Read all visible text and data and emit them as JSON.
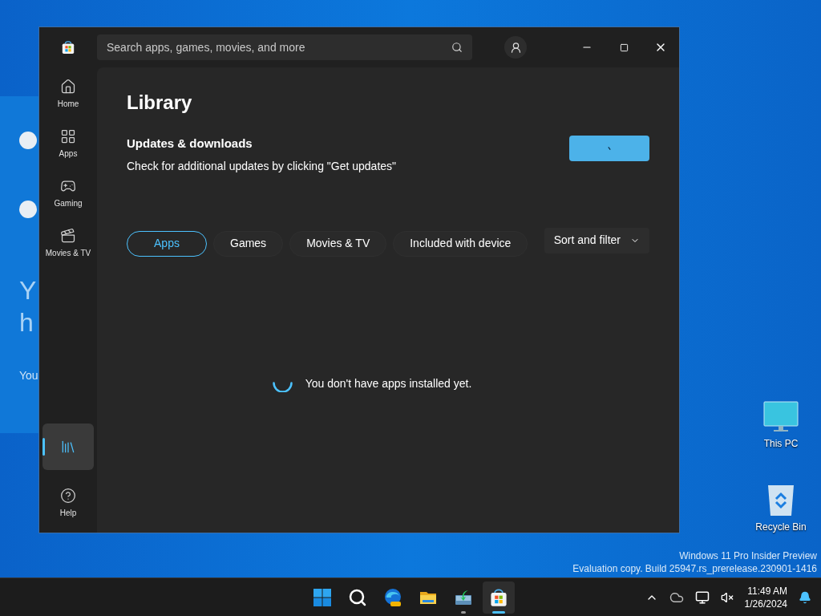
{
  "background_window": {
    "texts": [
      "Y",
      "h",
      "You"
    ]
  },
  "store": {
    "search": {
      "placeholder": "Search apps, games, movies, and more"
    },
    "sidebar": [
      {
        "kind": "home",
        "label": "Home",
        "selected": false
      },
      {
        "kind": "apps",
        "label": "Apps",
        "selected": false
      },
      {
        "kind": "gaming",
        "label": "Gaming",
        "selected": false
      },
      {
        "kind": "movies",
        "label": "Movies & TV",
        "selected": false
      },
      {
        "kind": "library",
        "selected": true
      },
      {
        "kind": "help",
        "label": "Help",
        "selected": false
      }
    ],
    "title": "Library",
    "updates": {
      "heading": "Updates & downloads",
      "text": "Check for additional updates by clicking \"Get updates\"",
      "busy": true
    },
    "filters": [
      {
        "label": "Apps",
        "selected": true
      },
      {
        "label": "Games",
        "selected": false
      },
      {
        "label": "Movies & TV",
        "selected": false
      },
      {
        "label": "Included with device",
        "selected": false
      }
    ],
    "sort": "Sort and filter",
    "empty_message": "You don't have apps installed yet.",
    "loading": true
  },
  "desktop_icons": [
    {
      "kind": "pc",
      "label": "This PC"
    },
    {
      "kind": "bin",
      "label": "Recycle Bin"
    }
  ],
  "watermark": [
    "Windows 11 Pro Insider Preview",
    "Evaluation copy. Build 25947.rs_prerelease.230901-1416"
  ],
  "taskbar": {
    "apps": [
      {
        "kind": "start",
        "running": false,
        "selected": false
      },
      {
        "kind": "search",
        "running": false,
        "selected": false
      },
      {
        "kind": "edge",
        "running": false,
        "selected": false
      },
      {
        "kind": "explorer",
        "running": false,
        "selected": false
      },
      {
        "kind": "installer",
        "running": true,
        "selected": false
      },
      {
        "kind": "store",
        "running": true,
        "selected": true
      }
    ],
    "time": "11:49 AM",
    "date": "1/26/2024"
  }
}
